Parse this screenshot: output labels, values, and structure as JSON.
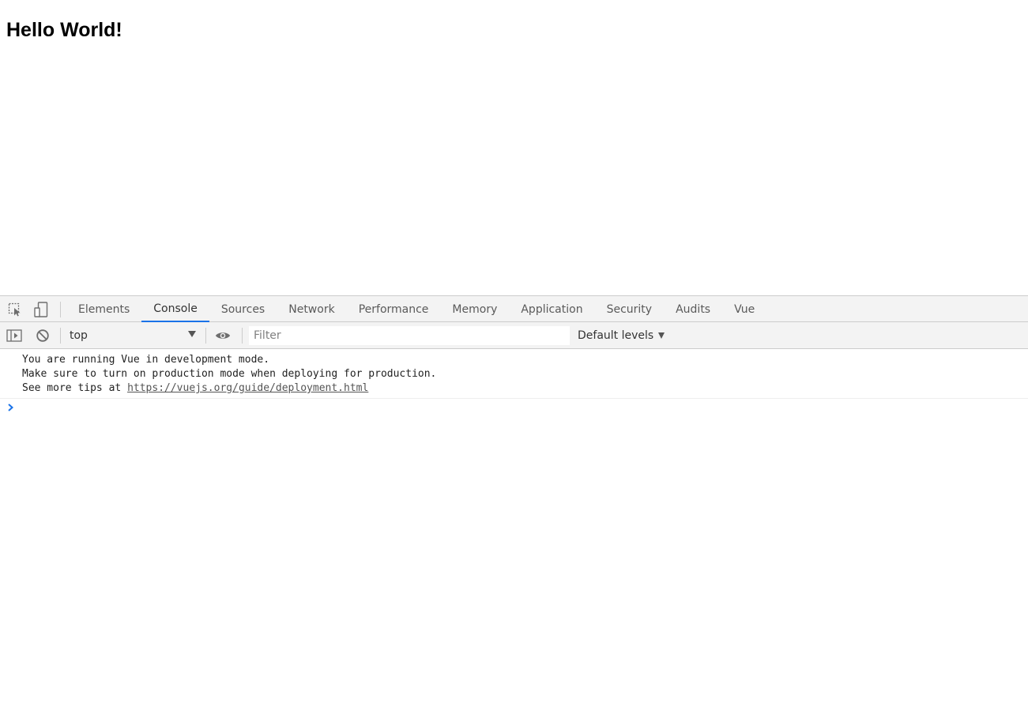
{
  "page": {
    "heading": "Hello World!"
  },
  "devtools": {
    "tabs": [
      {
        "label": "Elements",
        "active": false
      },
      {
        "label": "Console",
        "active": true
      },
      {
        "label": "Sources",
        "active": false
      },
      {
        "label": "Network",
        "active": false
      },
      {
        "label": "Performance",
        "active": false
      },
      {
        "label": "Memory",
        "active": false
      },
      {
        "label": "Application",
        "active": false
      },
      {
        "label": "Security",
        "active": false
      },
      {
        "label": "Audits",
        "active": false
      },
      {
        "label": "Vue",
        "active": false
      }
    ],
    "toolbar_icons": [
      "inspect-element-icon",
      "device-toolbar-icon"
    ],
    "console_toolbar": {
      "icons": [
        "show-sidebar-icon",
        "clear-console-icon",
        "eye-icon"
      ],
      "context_value": "top",
      "filter_value": "",
      "filter_placeholder": "Filter",
      "levels_label": "Default levels"
    },
    "console": {
      "message": {
        "line1": "You are running Vue in development mode.",
        "line2": "Make sure to turn on production mode when deploying for production.",
        "line3_prefix": "See more tips at ",
        "line3_link": "https://vuejs.org/guide/deployment.html"
      },
      "prompt_icon": "chevron-right-icon"
    },
    "colors": {
      "accent": "#1a73e8",
      "panel_bg": "#f3f3f3",
      "border": "#cccccc",
      "prompt": "#1a73e8"
    }
  }
}
